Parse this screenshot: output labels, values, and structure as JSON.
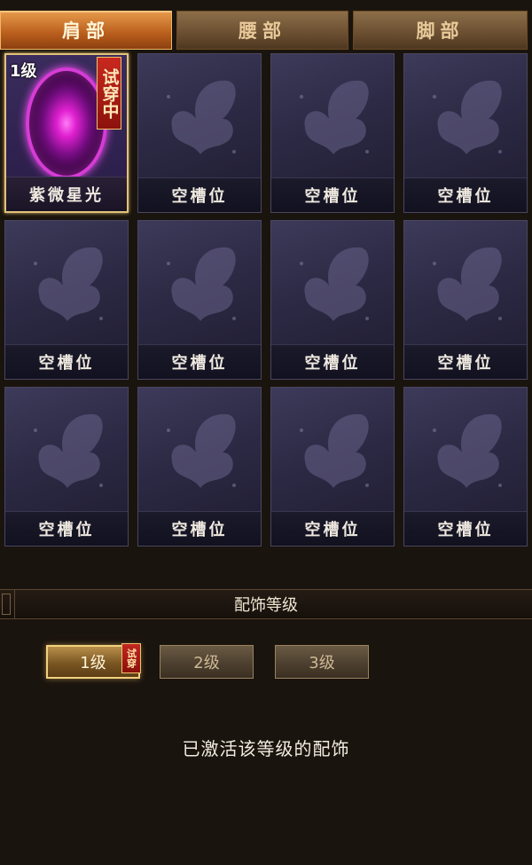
{
  "tabs": [
    {
      "label": "肩部",
      "active": true
    },
    {
      "label": "腰部",
      "active": false
    },
    {
      "label": "脚部",
      "active": false
    }
  ],
  "equipped_slot": {
    "level_badge": "1级",
    "trial_badge": "试穿中",
    "name": "紫微星光"
  },
  "empty_slot_label": "空槽位",
  "section": {
    "title": "配饰等级"
  },
  "levels": [
    {
      "label": "1级",
      "active": true,
      "trial_badge": "试穿"
    },
    {
      "label": "2级",
      "active": false
    },
    {
      "label": "3级",
      "active": false
    }
  ],
  "status_text": "已激活该等级的配饰",
  "colors": {
    "accent": "#e2c27a",
    "orb": "#e020d0",
    "tab_active": "#b85d1c"
  }
}
